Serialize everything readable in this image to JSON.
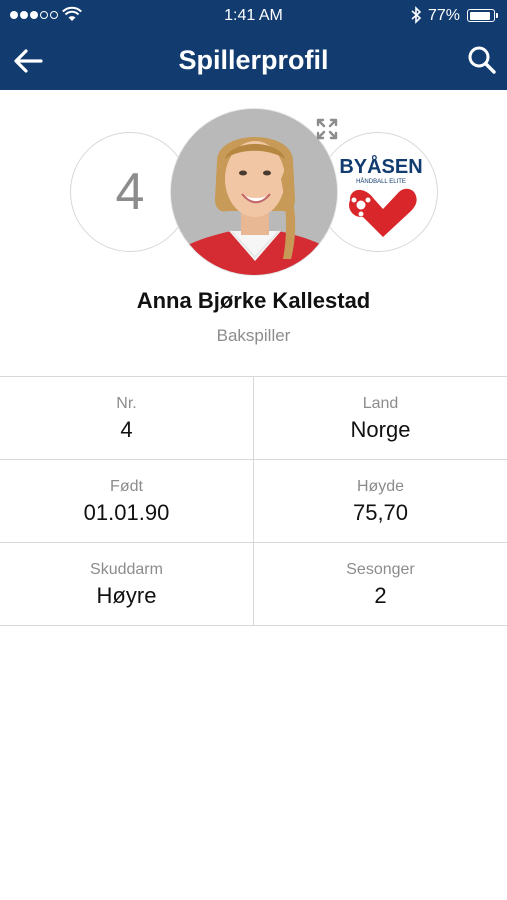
{
  "status_bar": {
    "time": "1:41 AM",
    "battery_percent": "77%",
    "battery_level": 0.77,
    "signal_bars_filled": 3,
    "signal_bars_total": 5
  },
  "nav": {
    "title": "Spillerprofil",
    "back_icon": "arrow-left-icon",
    "search_icon": "search-icon",
    "background_color": "#123c70"
  },
  "player": {
    "number": "4",
    "name": "Anna Bjørke Kallestad",
    "position": "Bakspiller"
  },
  "club_logo": {
    "text": "BYÅSEN",
    "subtext": "HÅNDBALL ELITE",
    "brand_color": "#d9262a",
    "text_color": "#123c70"
  },
  "stats": [
    [
      {
        "label": "Nr.",
        "value": "4"
      },
      {
        "label": "Land",
        "value": "Norge"
      }
    ],
    [
      {
        "label": "Født",
        "value": "01.01.90"
      },
      {
        "label": "Høyde",
        "value": "75,70"
      }
    ],
    [
      {
        "label": "Skuddarm",
        "value": "Høyre"
      },
      {
        "label": "Sesonger",
        "value": "2"
      }
    ]
  ]
}
